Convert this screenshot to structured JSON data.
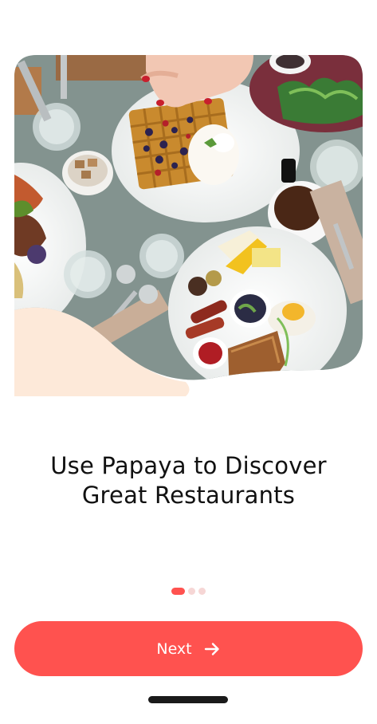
{
  "onboarding": {
    "hero_image": "breakfast-table-photo",
    "title_line1": "Use Papaya to Discover",
    "title_line2": "Great Restaurants",
    "page_indicator": {
      "current": 1,
      "total": 3
    },
    "next_label": "Next",
    "next_icon": "arrow-right-icon"
  },
  "colors": {
    "accent": "#ff524f",
    "dot_inactive": "#f6d6d5",
    "wave": "#fde9d9",
    "text": "#111111"
  }
}
